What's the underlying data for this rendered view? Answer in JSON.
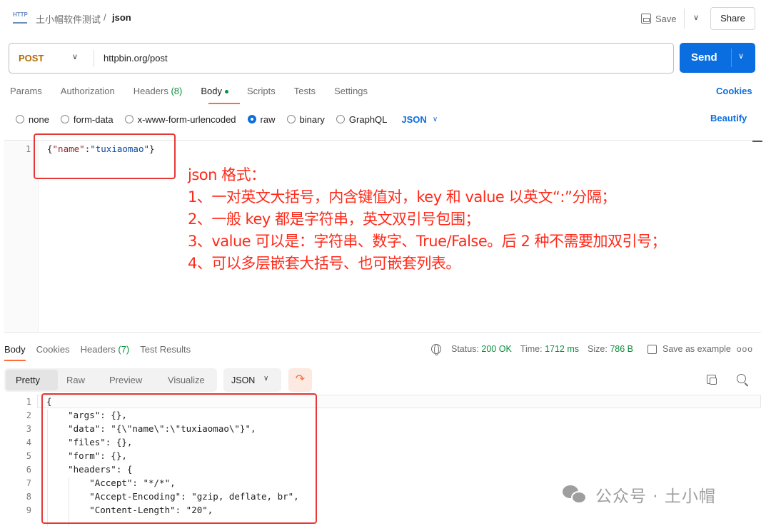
{
  "breadcrumb": {
    "icon_label": "HTTP",
    "parent": "土小帽软件测试",
    "separator": "/",
    "current": "json"
  },
  "header_actions": {
    "save_label": "Save",
    "share_label": "Share"
  },
  "request": {
    "method": "POST",
    "url": "httpbin.org/post",
    "send_label": "Send"
  },
  "request_tabs": [
    {
      "label": "Params"
    },
    {
      "label": "Authorization"
    },
    {
      "label": "Headers",
      "count": "(8)"
    },
    {
      "label": "Body",
      "active": true
    },
    {
      "label": "Scripts"
    },
    {
      "label": "Tests"
    },
    {
      "label": "Settings"
    }
  ],
  "cookies_label": "Cookies",
  "body_types": [
    {
      "label": "none",
      "selected": false
    },
    {
      "label": "form-data",
      "selected": false
    },
    {
      "label": "x-www-form-urlencoded",
      "selected": false
    },
    {
      "label": "raw",
      "selected": true
    },
    {
      "label": "binary",
      "selected": false
    },
    {
      "label": "GraphQL",
      "selected": false
    }
  ],
  "raw_format": "JSON",
  "beautify_label": "Beautify",
  "request_body": {
    "line_number": "1",
    "open": "{",
    "key": "\"name\"",
    "colon": ":",
    "value": "\"tuxiaomao\"",
    "close": "}"
  },
  "annotation": [
    "json 格式：",
    "1、一对英文大括号，内含键值对，key 和 value 以英文“:”分隔；",
    "2、一般 key 都是字符串，英文双引号包围；",
    "3、value 可以是：字符串、数字、True/False。后 2 种不需要加双引号；",
    "4、可以多层嵌套大括号、也可嵌套列表。"
  ],
  "response_tabs": [
    {
      "label": "Body",
      "active": true
    },
    {
      "label": "Cookies"
    },
    {
      "label": "Headers",
      "count": "(7)"
    },
    {
      "label": "Test Results"
    }
  ],
  "response_meta": {
    "status_label": "Status:",
    "status_value": "200 OK",
    "time_label": "Time:",
    "time_value": "1712 ms",
    "size_label": "Size:",
    "size_value": "786 B",
    "save_example_label": "Save as example",
    "more": "ooo"
  },
  "view_modes": [
    "Pretty",
    "Raw",
    "Preview",
    "Visualize"
  ],
  "response_format": "JSON",
  "response_lines": [
    {
      "n": "1",
      "code": "{"
    },
    {
      "n": "2",
      "code": "    \"args\": {},"
    },
    {
      "n": "3",
      "code": "    \"data\": \"{\\\"name\\\":\\\"tuxiaomao\\\"}\","
    },
    {
      "n": "4",
      "code": "    \"files\": {},"
    },
    {
      "n": "5",
      "code": "    \"form\": {},"
    },
    {
      "n": "6",
      "code": "    \"headers\": {"
    },
    {
      "n": "7",
      "code": "        \"Accept\": \"*/*\","
    },
    {
      "n": "8",
      "code": "        \"Accept-Encoding\": \"gzip, deflate, br\","
    },
    {
      "n": "9",
      "code": "        \"Content-Length\": \"20\","
    }
  ],
  "watermark": "公众号 · 土小帽",
  "colors": {
    "accent_blue": "#0b6ee0",
    "method_orange": "#b36b00",
    "tab_underline": "#ff6c37",
    "status_green": "#0a8f3a",
    "annotation_red": "#ff2a1a",
    "highlight_box_red": "#e53935"
  },
  "icons": [
    "http-icon",
    "save-icon",
    "chevron-down-icon",
    "globe-icon",
    "save-example-icon",
    "more-icon",
    "wrap-lines-icon",
    "copy-icon",
    "search-icon",
    "wechat-icon"
  ]
}
